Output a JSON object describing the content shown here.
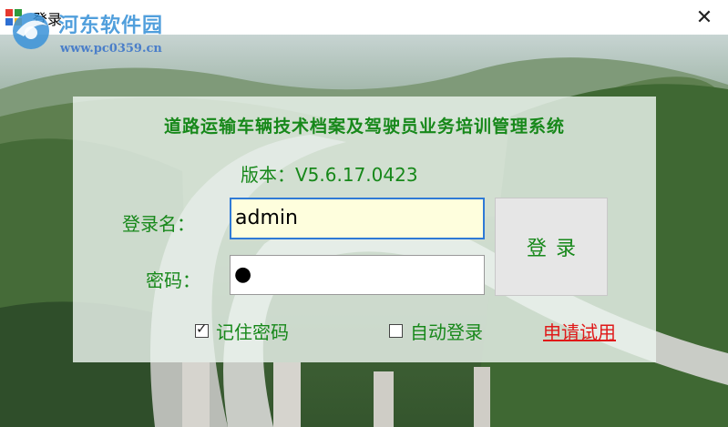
{
  "window": {
    "title": "登录",
    "close_glyph": "✕"
  },
  "watermark": {
    "name": "河东软件园",
    "url": "www.pc0359.cn"
  },
  "login": {
    "system_title": "道路运输车辆技术档案及驾驶员业务培训管理系统",
    "version_text": "版本：V5.6.17.0423",
    "username_label": "登录名：",
    "username_value": "admin",
    "password_label": "密码：",
    "password_value": "●",
    "login_button": "登录",
    "remember_label": "记住密码",
    "remember_checked": true,
    "auto_login_label": "自动登录",
    "auto_login_checked": false,
    "apply_trial_link": "申请试用"
  },
  "colors": {
    "label_green": "#17881a",
    "link_red": "#e01818",
    "input_focus_border": "#2f7ad6",
    "input_focus_bg": "#fefedd"
  },
  "icons": [
    "app-icon",
    "close-icon",
    "watermark-logo-icon",
    "checkmark-icon"
  ]
}
